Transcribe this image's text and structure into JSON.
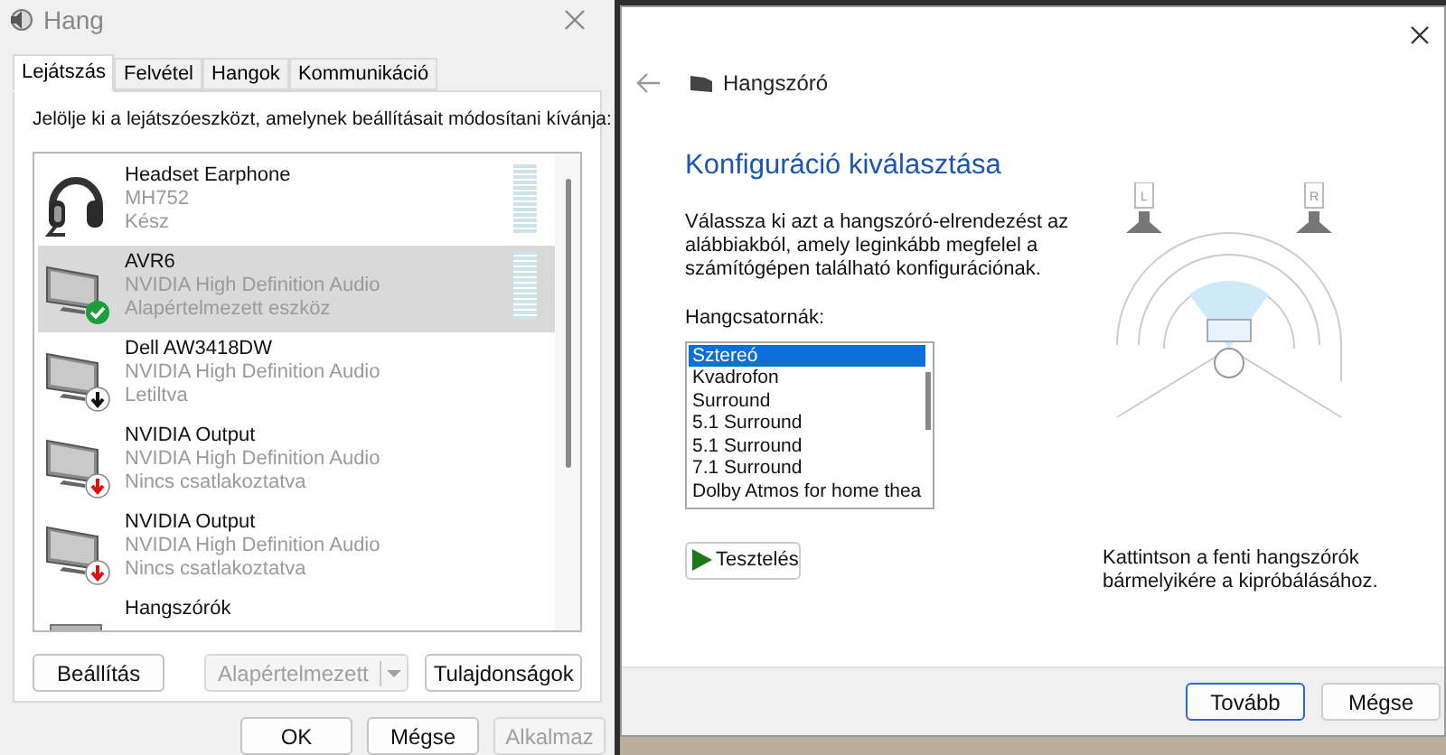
{
  "sound_dialog": {
    "title": "Hang",
    "tabs": [
      {
        "label": "Lejátszás",
        "selected": true
      },
      {
        "label": "Felvétel",
        "selected": false
      },
      {
        "label": "Hangok",
        "selected": false
      },
      {
        "label": "Kommunikáció",
        "selected": false
      }
    ],
    "instruction": "Jelölje ki a lejátszóeszközt, amelynek beállításait módosítani kívánja:",
    "devices": [
      {
        "name": "Headset Earphone",
        "driver": "MH752",
        "status": "Kész",
        "kind": "headset",
        "is_default": false,
        "disabled": false,
        "unplugged": false,
        "selected": false,
        "level": 0
      },
      {
        "name": "AVR6",
        "driver": "NVIDIA High Definition Audio",
        "status": "Alapértelmezett eszköz",
        "kind": "monitor",
        "is_default": true,
        "disabled": false,
        "unplugged": false,
        "selected": true,
        "level": 0
      },
      {
        "name": "Dell AW3418DW",
        "driver": "NVIDIA High Definition Audio",
        "status": "Letiltva",
        "kind": "monitor",
        "is_default": false,
        "disabled": true,
        "unplugged": false,
        "selected": false
      },
      {
        "name": "NVIDIA Output",
        "driver": "NVIDIA High Definition Audio",
        "status": "Nincs csatlakoztatva",
        "kind": "monitor",
        "is_default": false,
        "disabled": false,
        "unplugged": true,
        "selected": false
      },
      {
        "name": "NVIDIA Output",
        "driver": "NVIDIA High Definition Audio",
        "status": "Nincs csatlakoztatva",
        "kind": "monitor",
        "is_default": false,
        "disabled": false,
        "unplugged": true,
        "selected": false
      },
      {
        "name": "Hangszórók",
        "kind": "speaker",
        "selected": false
      }
    ],
    "buttons": [
      {
        "label": "Beállítás",
        "disabled": false
      },
      {
        "label": "Alapértelmezett",
        "disabled": true,
        "kind": "split"
      },
      {
        "label": "Tulajdonságok",
        "disabled": false
      }
    ],
    "footer_buttons": [
      {
        "label": "OK",
        "disabled": false
      },
      {
        "label": "Mégse",
        "disabled": false
      },
      {
        "label": "Alkalmaz",
        "disabled": true
      }
    ]
  },
  "speaker_setup": {
    "title": "Hangszóró",
    "heading": "Konfiguráció kiválasztása",
    "description": "Válassza ki azt a hangszóró-elrendezést az alábbiakból, amely leginkább megfelel a számítógépen található konfigurációnak.",
    "channels_label": "Hangcsatornák:",
    "channels": [
      {
        "label": "Sztereó",
        "selected": true
      },
      {
        "label": "Kvadrofon",
        "selected": false
      },
      {
        "label": "Surround",
        "selected": false
      },
      {
        "label": "5.1 Surround",
        "selected": false
      },
      {
        "label": "5.1 Surround",
        "selected": false
      },
      {
        "label": "7.1 Surround",
        "selected": false
      },
      {
        "label": "Dolby Atmos for home thea",
        "selected": false
      }
    ],
    "test_button": "Tesztelés",
    "speaker_labels": [
      "L",
      "R"
    ],
    "hint": "Kattintson a fenti hangszórók bármelyikére a kipróbálásához.",
    "footer_buttons": [
      {
        "label": "Tovább",
        "kind": "default"
      },
      {
        "label": "Mégse",
        "kind": "normal"
      }
    ]
  }
}
